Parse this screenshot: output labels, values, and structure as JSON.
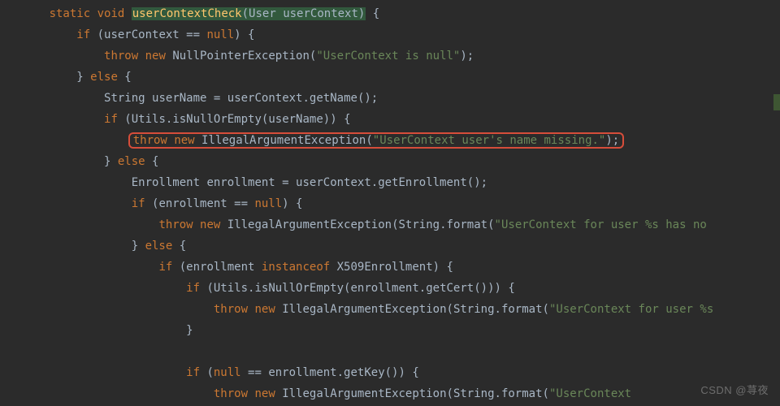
{
  "code": {
    "indent": "    ",
    "decl": {
      "kw_static": "static",
      "kw_void": "void",
      "method": "userContextCheck",
      "param_type": "User",
      "param_name": "userContext"
    },
    "null_lit": "null",
    "kw_if": "if",
    "kw_else": "else",
    "kw_throw": "throw",
    "kw_new": "new",
    "kw_instanceof": "instanceof",
    "types": {
      "NPE": "NullPointerException",
      "IAE": "IllegalArgumentException",
      "String": "String",
      "Utils": "Utils",
      "Enrollment": "Enrollment",
      "X509Enrollment": "X509Enrollment"
    },
    "idents": {
      "userContext": "userContext",
      "userName": "userName",
      "enrollment": "enrollment"
    },
    "methods": {
      "getName": "getName",
      "isNullOrEmpty": "isNullOrEmpty",
      "getEnrollment": "getEnrollment",
      "format": "format",
      "getCert": "getCert",
      "getKey": "getKey"
    },
    "strings": {
      "uc_null": "\"UserContext is null\"",
      "name_missing": "\"UserContext user's name missing.\"",
      "no_enrollment": "\"UserContext for user %s has no",
      "cert_missing": "\"UserContext for user %s",
      "key_missing": "\"UserContext"
    }
  },
  "watermark": "CSDN @荨夜"
}
